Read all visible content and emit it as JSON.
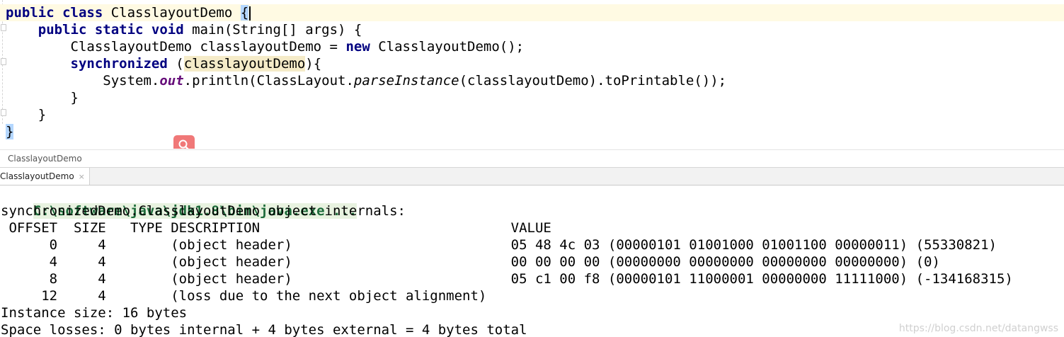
{
  "editor": {
    "lines": [
      {
        "id": "l1",
        "segments": [
          {
            "t": "public class",
            "c": "kw"
          },
          {
            "t": " ClasslayoutDemo "
          },
          {
            "t": "{",
            "c": "brace-hl"
          }
        ],
        "caret": true
      },
      {
        "id": "l2",
        "segments": [
          {
            "t": "    "
          },
          {
            "t": "public static void",
            "c": "kw"
          },
          {
            "t": " main(String[] args) {"
          }
        ]
      },
      {
        "id": "l3",
        "segments": [
          {
            "t": "        ClasslayoutDemo classlayoutDemo = "
          },
          {
            "t": "new",
            "c": "kw"
          },
          {
            "t": " ClasslayoutDemo();"
          }
        ]
      },
      {
        "id": "l4",
        "segments": [
          {
            "t": "        "
          },
          {
            "t": "synchronized",
            "c": "kw"
          },
          {
            "t": " ("
          },
          {
            "t": "classlayoutDemo",
            "c": "var-hl"
          },
          {
            "t": "){"
          }
        ]
      },
      {
        "id": "l5",
        "segments": [
          {
            "t": "            System."
          },
          {
            "t": "out",
            "c": "field"
          },
          {
            "t": ".println(ClassLayout."
          },
          {
            "t": "parseInstance",
            "c": "italic"
          },
          {
            "t": "(classlayoutDemo).toPrintable());"
          }
        ]
      },
      {
        "id": "l6",
        "segments": [
          {
            "t": "        }"
          }
        ]
      },
      {
        "id": "l7",
        "segments": [
          {
            "t": "    }"
          }
        ]
      },
      {
        "id": "l8",
        "segments": [
          {
            "t": "}",
            "c": "brace-hl"
          }
        ]
      }
    ]
  },
  "breadcrumb": {
    "label": "ClasslayoutDemo"
  },
  "run_tab": {
    "label": "ClasslayoutDemo",
    "close": "×"
  },
  "console": {
    "command": "C:\\software\\java\\jdk1.8\\bin\\java.exe ...",
    "lines": [
      "synchronizedDemo.ClasslayoutDemo object internals:",
      " OFFSET  SIZE   TYPE DESCRIPTION                               VALUE",
      "      0     4        (object header)                           05 48 4c 03 (00000101 01001000 01001100 00000011) (55330821)",
      "      4     4        (object header)                           00 00 00 00 (00000000 00000000 00000000 00000000) (0)",
      "      8     4        (object header)                           05 c1 00 f8 (00000101 11000001 00000000 11111000) (-134168315)",
      "     12     4        (loss due to the next object alignment)",
      "Instance size: 16 bytes",
      "Space losses: 0 bytes internal + 4 bytes external = 4 bytes total"
    ]
  },
  "watermark": "https://blog.csdn.net/datangwss",
  "colors": {
    "keyword": "#000080",
    "field": "#660e7a",
    "caret_line": "#fffae3",
    "command": "#1d6b3a"
  }
}
